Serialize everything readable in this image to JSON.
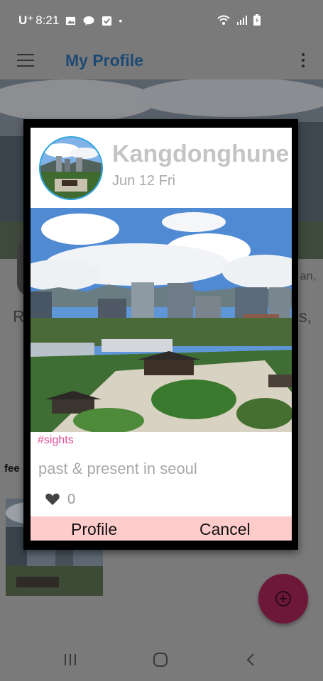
{
  "status_bar": {
    "carrier": "U⁺",
    "time": "8:21",
    "dot": "•"
  },
  "app_bar": {
    "title": "My Profile"
  },
  "background": {
    "bio_line1_fragment": "an,",
    "bio_line2_start": "R",
    "bio_line2_end": "s,",
    "feed_label": "fee"
  },
  "dialog": {
    "username": "Kangdonghune",
    "date": "Jun 12 Fri",
    "tag": "#sights",
    "caption": "past & present in seoul",
    "like_count": "0",
    "profile_button": "Profile",
    "cancel_button": "Cancel"
  },
  "colors": {
    "accent_blue": "#29a3df",
    "tag_pink": "#e04b9a",
    "action_bar": "#ffcccc",
    "fab": "#6e1839"
  }
}
